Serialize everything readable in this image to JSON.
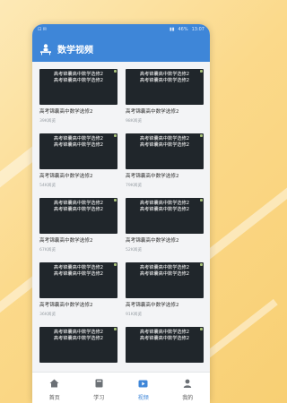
{
  "status_bar": {
    "left_icons": "⊡ ✉",
    "battery": "46%",
    "time": "13:07"
  },
  "header": {
    "title": "数学视频",
    "logo_icon": "teacher-desk-icon"
  },
  "videos": [
    {
      "thumb_line1": "高考锦囊高中数学选修2",
      "thumb_line2": "高考锦囊高中数学选修2",
      "title": "高考锦囊高中数学选修2",
      "views": "39K阅览"
    },
    {
      "thumb_line1": "高考锦囊高中数学选修2",
      "thumb_line2": "高考锦囊高中数学选修2",
      "title": "高考锦囊高中数学选修2",
      "views": "98K阅览"
    },
    {
      "thumb_line1": "高考锦囊高中数学选修2",
      "thumb_line2": "高考锦囊高中数学选修2",
      "title": "高考锦囊高中数学选修2",
      "views": "54K阅览"
    },
    {
      "thumb_line1": "高考锦囊高中数学选修2",
      "thumb_line2": "高考锦囊高中数学选修2",
      "title": "高考锦囊高中数学选修2",
      "views": "79K阅览"
    },
    {
      "thumb_line1": "高考锦囊高中数学选修2",
      "thumb_line2": "高考锦囊高中数学选修2",
      "title": "高考锦囊高中数学选修2",
      "views": "67K阅览"
    },
    {
      "thumb_line1": "高考锦囊高中数学选修2",
      "thumb_line2": "高考锦囊高中数学选修2",
      "title": "高考锦囊高中数学选修2",
      "views": "52K阅览"
    },
    {
      "thumb_line1": "高考锦囊高中数学选修2",
      "thumb_line2": "高考锦囊高中数学选修2",
      "title": "高考锦囊高中数学选修2",
      "views": "36K阅览"
    },
    {
      "thumb_line1": "高考锦囊高中数学选修2",
      "thumb_line2": "高考锦囊高中数学选修2",
      "title": "高考锦囊高中数学选修2",
      "views": "91K阅览"
    },
    {
      "thumb_line1": "高考锦囊高中数学选修2",
      "thumb_line2": "高考锦囊高中数学选修2",
      "title": "",
      "views": ""
    },
    {
      "thumb_line1": "高考锦囊高中数学选修2",
      "thumb_line2": "高考锦囊高中数学选修2",
      "title": "",
      "views": ""
    }
  ],
  "tabs": [
    {
      "label": "首页",
      "icon": "home-icon",
      "active": false
    },
    {
      "label": "学习",
      "icon": "book-icon",
      "active": false
    },
    {
      "label": "视频",
      "icon": "video-icon",
      "active": true
    },
    {
      "label": "我的",
      "icon": "user-icon",
      "active": false
    }
  ],
  "colors": {
    "primary": "#3e86d8",
    "thumb_bg": "#20262b",
    "background": "#f3f4f6"
  }
}
